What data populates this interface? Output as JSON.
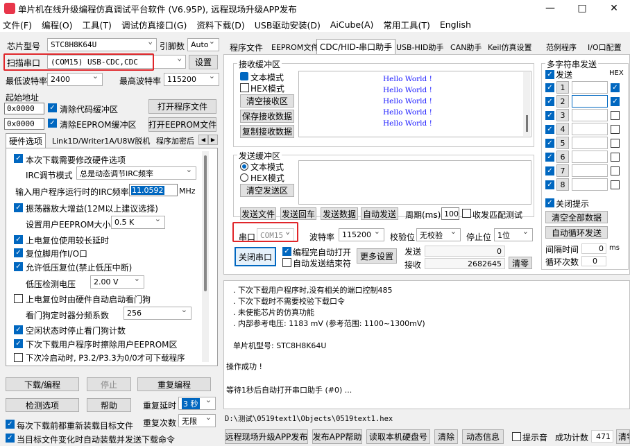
{
  "window": {
    "title": "单片机在线升级编程仿真调试平台软件 (V6.95P), 远程现场升级APP发布"
  },
  "menu": [
    "文件(F)",
    "编程(O)",
    "工具(T)",
    "调试仿真接口(G)",
    "资料下载(D)",
    "USB驱动安装(D)",
    "AiCube(A)",
    "常用工具(T)",
    "English"
  ],
  "left": {
    "chip_label": "芯片型号",
    "chip_value": "STC8H8K64U",
    "pin_label": "引脚数",
    "pin_value": "Auto",
    "scan_label": "扫描串口",
    "port_value": "(COM15) USB-CDC,CDC",
    "settings_btn": "设置",
    "min_baud_label": "最低波特率",
    "min_baud": "2400",
    "max_baud_label": "最高波特率",
    "max_baud": "115200",
    "start_addr_label": "起始地址",
    "addr1": "0x0000",
    "clear_code": "清除代码缓冲区",
    "open_prog": "打开程序文件",
    "addr2": "0x0000",
    "clear_eeprom": "清除EEPROM缓冲区",
    "open_eeprom": "打开EEPROM文件",
    "tabs": [
      "硬件选项",
      "Link1D/Writer1A/U8W脱机",
      "程序加密后"
    ],
    "hw": {
      "opt1": "本次下载需要修改硬件选项",
      "irc_mode_label": "IRC调节模式",
      "irc_mode": "总是动态调节IRC频率",
      "irc_freq_label": "输入用户程序运行时的IRC频率",
      "irc_freq": "11.0592",
      "irc_unit": "MHz",
      "osc": "振荡器放大增益(12M以上建议选择)",
      "eeprom_size_label": "设置用户EEPROM大小",
      "eeprom_size": "0.5 K",
      "por_delay": "上电复位使用较长延时",
      "reset_io": "复位脚用作I/O口",
      "lvr": "允许低压复位(禁止低压中断)",
      "lvr_volt_label": "低压检测电压",
      "lvr_volt": "2.00 V",
      "wdt_por": "上电复位时由硬件自动启动看门狗",
      "wdt_div_label": "看门狗定时器分频系数",
      "wdt_div": "256",
      "wdt_idle": "空闲状态时停止看门狗计数",
      "erase_eeprom": "下次下载用户程序时擦除用户EEPROM区",
      "cold_boot": "下次冷启动时, P3.2/P3.3为0/0才可下载程序"
    },
    "download_btn": "下载/编程",
    "stop_btn": "停止",
    "reprog_btn": "重复编程",
    "detect_btn": "检测选项",
    "help_btn": "帮助",
    "repeat_delay_label": "重复延时",
    "repeat_delay": "3 秒",
    "repeat_count_label": "重复次数",
    "repeat_count": "无限",
    "reload_before": "每次下载前都重新装载目标文件",
    "auto_load": "当目标文件变化时自动装载并发送下载命令"
  },
  "right": {
    "tabs": [
      "程序文件",
      "EEPROM文件",
      "CDC/HID-串口助手",
      "USB-HID助手",
      "CAN助手",
      "Keil仿真设置",
      "范例程序",
      "I/O口配置"
    ],
    "recv": {
      "title": "接收缓冲区",
      "text_mode": "文本模式",
      "hex_mode": "HEX模式",
      "clear": "清空接收区",
      "save": "保存接收数据",
      "copy": "复制接收数据",
      "lines": [
        "Hello World !",
        "Hello World !",
        "Hello World !",
        "Hello World !",
        "Hello World !"
      ]
    },
    "send": {
      "title": "发送缓冲区",
      "text_mode": "文本模式",
      "hex_mode": "HEX模式",
      "clear": "清空发送区",
      "send_file": "发送文件",
      "send_enter": "发送回车",
      "send_data": "发送数据",
      "auto_send": "自动发送",
      "period_label": "周期(ms)",
      "period": "100",
      "rx_trigger": "收发匹配测试"
    },
    "serial": {
      "port_label": "串口",
      "port": "COM15",
      "baud_label": "波特率",
      "baud": "115200",
      "parity_label": "校验位",
      "parity": "无校验",
      "stop_label": "停止位",
      "stop": "1位",
      "close_btn": "关闭串口",
      "auto_open": "编程完自动打开",
      "auto_stop": "自动发送结束符",
      "more_btn": "更多设置",
      "tx_label": "发送",
      "tx": "0",
      "rx_label": "接收",
      "rx": "2682645",
      "clear_btn": "清零"
    },
    "multi": {
      "title": "多字符串发送",
      "send_col": "发送",
      "hex_col": "HEX",
      "rows": [
        "1",
        "2",
        "3",
        "4",
        "5",
        "6",
        "7",
        "8"
      ],
      "close_tip": "关闭提示",
      "clear_all": "清空全部数据",
      "auto_loop": "自动循环发送",
      "interval_label": "间隔时间",
      "interval": "0",
      "interval_unit": "ms",
      "loop_label": "循环次数",
      "loop": "0"
    },
    "log": [
      ". 下次下载用户程序时,没有相关的端口控制485",
      ". 下次下载时不需要校验下载口令",
      ". 未使能芯片的仿真功能",
      ". 内部参考电压: 1183 mV (参考范围: 1100~1300mV)",
      "",
      "单片机型号: STC8H8K64U",
      "",
      "操作成功 !",
      "",
      "等待1秒后自动打开串口助手 (#0) ..."
    ],
    "file_path": "D:\\测试\\0519text1\\Objects\\0519text1.hex",
    "bottom": {
      "publish": "远程现场升级APP发布",
      "app_help": "发布APP帮助",
      "read_disk": "读取本机硬盘号",
      "clear": "清除",
      "dynamic": "动态信息",
      "sound": "提示音",
      "success_label": "成功计数",
      "success": "471",
      "clear2": "清零"
    }
  },
  "colors": {
    "accent": "#0067c0",
    "highlight": "#e0262a",
    "hello": "#1a1aff"
  }
}
